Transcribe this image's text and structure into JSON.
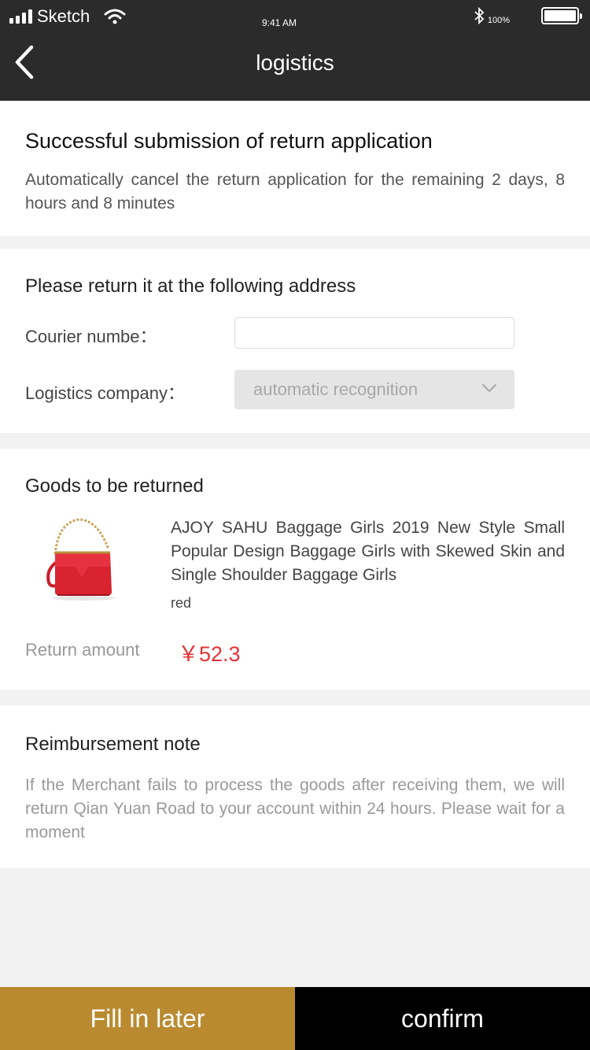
{
  "status_bar": {
    "carrier": "Sketch",
    "time": "9:41 AM",
    "battery": "100%"
  },
  "nav": {
    "title": "logistics",
    "back_icon": "chevron-left-icon"
  },
  "submission": {
    "title": "Successful submission of return application",
    "countdown_text": "Automatically cancel the return application for the remaining 2 days, 8 hours and 8 minutes"
  },
  "return_address": {
    "title": "Please return it at the following address",
    "courier_label": "Courier numbe：",
    "courier_value": "",
    "company_label": "Logistics company：",
    "company_value": "automatic recognition"
  },
  "goods": {
    "title": "Goods to be returned",
    "product_name": "AJOY SAHU Baggage Girls 2019 New Style Small Popular Design Baggage Girls with Skewed Skin and Single Shoulder Baggage Girls",
    "product_color": "red",
    "amount_label": "Return amount",
    "amount_value": "￥52.3"
  },
  "reimbursement": {
    "title": "Reimbursement note",
    "text": "If the Merchant fails to process the goods after receiving them, we will return Qian Yuan Road to your account within 24 hours. Please wait for a moment"
  },
  "footer": {
    "later_label": "Fill in later",
    "confirm_label": "confirm"
  },
  "colors": {
    "header_bg": "#2b2b2b",
    "price": "#e63236",
    "later_bg": "#b98a30",
    "confirm_bg": "#000000"
  }
}
